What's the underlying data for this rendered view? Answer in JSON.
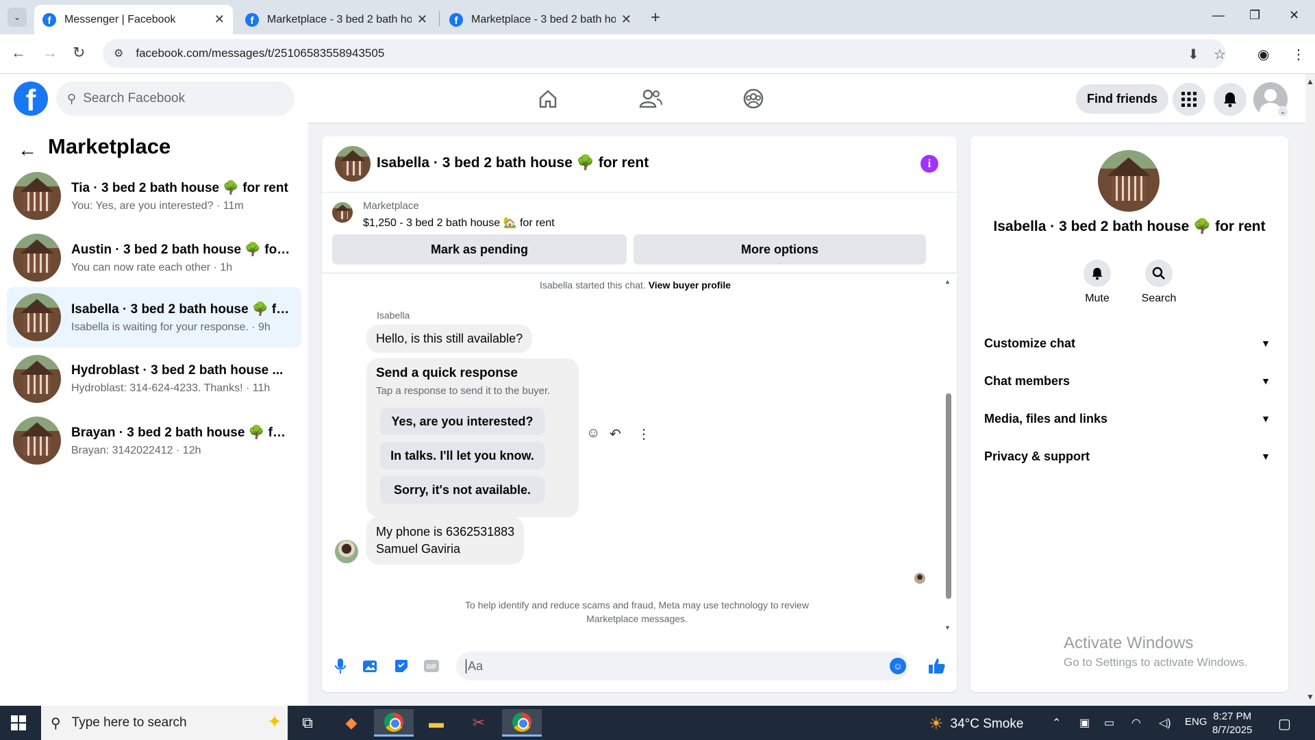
{
  "browser": {
    "tabs": [
      {
        "title": "Messenger | Facebook",
        "active": true
      },
      {
        "title": "Marketplace - 3 bed 2 bath hou",
        "active": false
      },
      {
        "title": "Marketplace - 3 bed 2 bath hou",
        "active": false
      }
    ],
    "url": "facebook.com/messages/t/25106583558943505"
  },
  "fbnav": {
    "search_placeholder": "Search Facebook",
    "find_friends_label": "Find friends"
  },
  "sidebar": {
    "title": "Marketplace",
    "conversations": [
      {
        "name": "Tia · 3 bed 2 bath house 🌳 for rent",
        "preview": "You: Yes, are you interested? · 11m",
        "selected": false
      },
      {
        "name": "Austin · 3 bed 2 bath house 🌳 for...",
        "preview": "You can now rate each other · 1h",
        "selected": false
      },
      {
        "name": "Isabella · 3 bed 2 bath house 🌳 fo...",
        "preview": "Isabella is waiting for your response. · 9h",
        "selected": true
      },
      {
        "name": "Hydroblast · 3 bed 2 bath house ...",
        "preview": "Hydroblast: 314-624-4233. Thanks! · 11h",
        "selected": false
      },
      {
        "name": "Brayan · 3 bed 2 bath house 🌳 for...",
        "preview": "Brayan: 3142022412 · 12h",
        "selected": false
      }
    ]
  },
  "chat": {
    "title": "Isabella · 3 bed 2 bath house 🌳 for rent",
    "listing_source": "Marketplace",
    "listing_text": "$1,250 - 3 bed 2 bath house 🏡 for rent",
    "mark_pending_label": "Mark as pending",
    "more_options_label": "More options",
    "started_text": "Isabella started this chat. ",
    "view_buyer_label": "View buyer profile",
    "sender_name": "Isabella",
    "message1": "Hello, is this still available?",
    "quick_response_title": "Send a quick response",
    "quick_response_sub": "Tap a response to send it to the buyer.",
    "quick_responses": [
      "Yes, are you interested?",
      "In talks. I'll let you know.",
      "Sorry, it's not available."
    ],
    "message2_line1": "My phone is 6362531883",
    "message2_line2": "Samuel Gaviria",
    "notice_line1": "To help identify and reduce scams and fraud, Meta may use technology to review",
    "notice_line2": "Marketplace messages.",
    "composer_placeholder": "Aa"
  },
  "rpanel": {
    "name": "Isabella · 3 bed 2 bath house 🌳 for rent",
    "mute_label": "Mute",
    "search_label": "Search",
    "rows": [
      "Customize chat",
      "Chat members",
      "Media, files and links",
      "Privacy & support"
    ],
    "watermark_line1": "Activate Windows",
    "watermark_line2": "Go to Settings to activate Windows."
  },
  "taskbar": {
    "search_placeholder": "Type here to search",
    "weather": "34°C  Smoke",
    "lang": "ENG",
    "time": "8:27 PM",
    "date": "8/7/2025"
  },
  "colors": {
    "fb_blue": "#1877f2",
    "info_purple": "#a033ff",
    "selected_row": "#ebf5ff"
  }
}
